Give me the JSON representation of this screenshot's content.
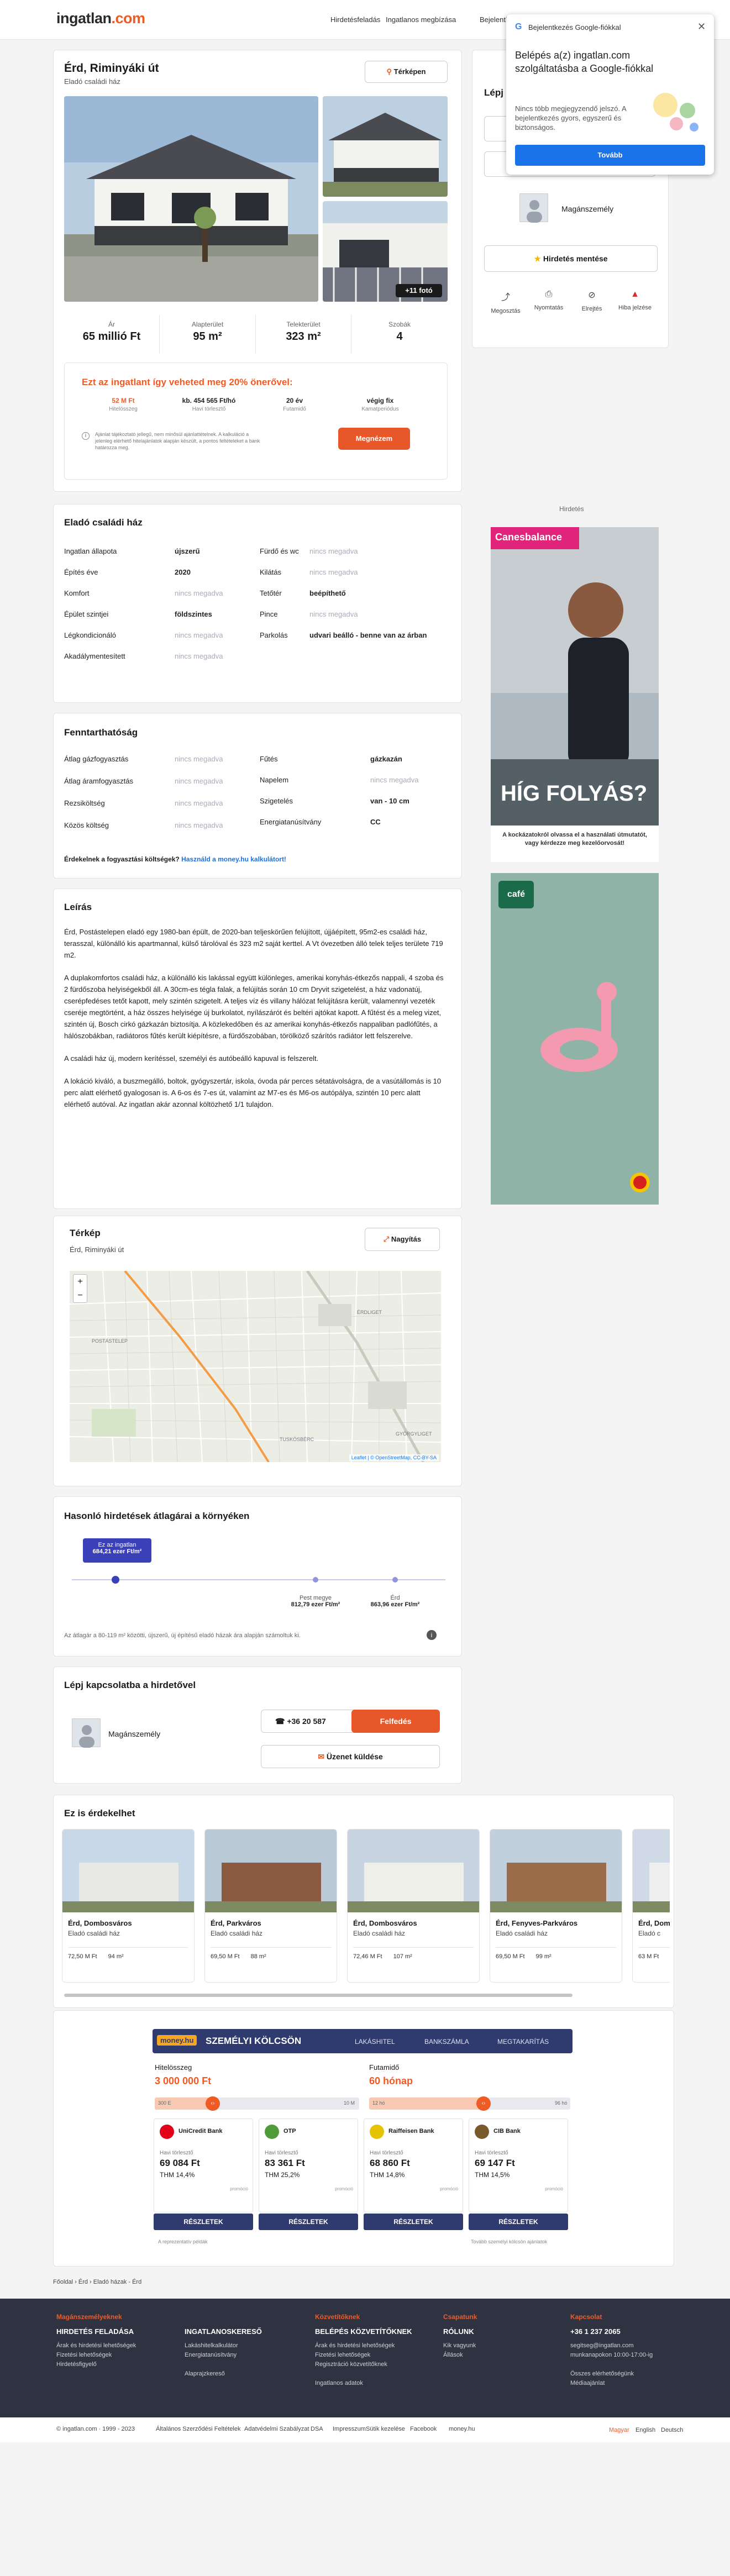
{
  "header": {
    "logo_a": "ingatlan",
    "logo_b": ".com",
    "nav": [
      "Hirdetésfeladás",
      "Ingatlanos megbízása",
      "Bejelentkezés"
    ]
  },
  "google_popup": {
    "title": "Bejelentkezés Google-fiókkal",
    "heading": "Belépés a(z) ingatlan.com szolgáltatásba a Google-fiókkal",
    "body": "Nincs több megjegyzendő jelszó. A bejelentkezés gyors, egyszerű és biztonságos.",
    "button": "Tovább"
  },
  "listing": {
    "title": "Érd, Riminyáki út",
    "subtitle": "Eladó családi ház",
    "map_button": "Térképen",
    "more_photos": "+11 fotó",
    "stats": [
      {
        "label": "Ár",
        "value": "65 millió Ft"
      },
      {
        "label": "Alapterület",
        "value": "95 m²"
      },
      {
        "label": "Telekterület",
        "value": "323 m²"
      },
      {
        "label": "Szobák",
        "value": "4"
      }
    ]
  },
  "loan_box": {
    "heading": "Ezt az ingatlant így veheted meg 20% önerővel:",
    "items": [
      {
        "value": "52 M Ft",
        "label": "Hitelösszeg"
      },
      {
        "value": "kb. 454 565 Ft/hó",
        "label": "Havi törlesztő"
      },
      {
        "value": "20 év",
        "label": "Futamidő"
      },
      {
        "value": "végig fix",
        "label": "Kamatperiódus"
      }
    ],
    "note": "Ajánlat tájékoztató jellegű, nem minősül ajánlattételnek. A kalkuláció a jelenleg elérhető hitelajánlatok alapján készült, a pontos feltételeket a bank határozza meg.",
    "button": "Megnézem"
  },
  "sidebar": {
    "contact_title": "Lépj",
    "agent": "Magánszemély",
    "save_ad": "Hirdetés mentése",
    "actions": [
      "Megosztás",
      "Nyomtatás",
      "Elrejtés",
      "Hiba jelzése"
    ],
    "ad_label": "Hirdetés",
    "ad1": {
      "brand": "Canesbalance",
      "headline": "HÍG FOLYÁS?",
      "sub": "A kockázatokról olvassa el a használati útmutatót, vagy kérdezze meg kezelőorvosát!"
    },
    "ad2": {
      "brand": "café"
    }
  },
  "details": {
    "title": "Eladó családi ház",
    "left": [
      {
        "label": "Ingatlan állapota",
        "value": "újszerű",
        "na": false
      },
      {
        "label": "Építés éve",
        "value": "2020",
        "na": false
      },
      {
        "label": "Komfort",
        "value": "nincs megadva",
        "na": true
      },
      {
        "label": "Épület szintjei",
        "value": "földszintes",
        "na": false
      },
      {
        "label": "Légkondicionáló",
        "value": "nincs megadva",
        "na": true
      },
      {
        "label": "Akadálymentesített",
        "value": "nincs megadva",
        "na": true
      }
    ],
    "right": [
      {
        "label": "Fürdő és wc",
        "value": "nincs megadva",
        "na": true
      },
      {
        "label": "Kilátás",
        "value": "nincs megadva",
        "na": true
      },
      {
        "label": "Tetőtér",
        "value": "beépíthető",
        "na": false
      },
      {
        "label": "Pince",
        "value": "nincs megadva",
        "na": true
      },
      {
        "label": "Parkolás",
        "value": "udvari beálló - benne van az árban",
        "na": false
      }
    ]
  },
  "costs": {
    "title": "Fenntarthatóság",
    "left": [
      {
        "label": "Átlag gázfogyasztás",
        "value": "nincs megadva"
      },
      {
        "label": "Átlag áramfogyasztás",
        "value": "nincs megadva"
      },
      {
        "label": "Rezsiköltség",
        "value": "nincs megadva"
      },
      {
        "label": "Közös költség",
        "value": "nincs megadva"
      }
    ],
    "right": [
      {
        "label": "Fűtés",
        "value": "gázkazán",
        "na": false
      },
      {
        "label": "Napelem",
        "value": "nincs megadva",
        "na": true
      },
      {
        "label": "Szigetelés",
        "value": "van - 10 cm",
        "na": false
      },
      {
        "label": "Energiatanúsítvány",
        "value": "CC",
        "na": false
      }
    ],
    "link_text": "Érdekelnek a fogyasztási költségek?",
    "link": "Használd a money.hu kalkulátort!"
  },
  "description": {
    "title": "Leírás",
    "paragraphs": [
      "Érd, Postástelepen eladó egy 1980-ban épült, de 2020-ban teljeskörűen felújított, újjáépített, 95m2-es családi ház, terasszal, különálló kis apartmannal, külső tárolóval és 323 m2 saját kerttel. A Vt övezetben álló telek teljes területe 719 m2.",
      "A duplakomfortos családi ház, a különálló kis lakással együtt különleges, amerikai konyhás-étkezős nappali, 4 szoba és 2 fürdőszoba helyiségekből áll. A 30cm-es tégla falak, a felújítás során 10 cm Dryvit szigetelést, a ház vadonatúj, cserépfedéses tetőt kapott, mely szintén szigetelt. A teljes víz és villany hálózat felújításra került, valamennyi vezeték cseréje megtörtént, a ház összes helyisége új burkolatot, nyílászárót és beltéri ajtókat kapott. A fűtést és a meleg vizet, szintén új, Bosch cirkó gázkazán biztosítja. A közlekedőben és az amerikai konyhás-étkezős nappaliban padlófűtés, a hálószobákban, radiátoros fűtés került kiépítésre, a fürdőszobában, törölköző szárítós radiátor lett felszerelve.",
      "A családi ház új, modern kerítéssel, személyi és autóbeálló kapuval is felszerelt.",
      "A lokáció kiváló, a buszmegálló, boltok, gyógyszertár, iskola, óvoda pár perces sétatávolságra, de a vasútállomás is 10 perc alatt elérhető gyalogosan is. A 6-os és 7-es út, valamint az M7-es és M6-os autópálya, szintén 10 perc alatt elérhető autóval. Az ingatlan akár azonnal költözhető 1/1 tulajdon."
    ]
  },
  "map": {
    "title": "Térkép",
    "address": "Érd, Riminyáki út",
    "button": "Nagyítás",
    "labels": [
      "POSTÁSTELEP",
      "ÉRDLIGET",
      "TUSKÓSBÉRC",
      "GYÖRGYLIGET"
    ],
    "attribution": "Leaflet | © OpenStreetMap, CC-BY-SA"
  },
  "price_stats": {
    "title": "Hasonló hirdetések átlagárai a környéken",
    "bubble_t": "Ez az ingatlan",
    "bubble_v": "684,21 ezer Ft/m²",
    "points": [
      {
        "label": "Pest megye",
        "value": "812,79 ezer Ft/m²"
      },
      {
        "label": "Érd",
        "value": "863,96 ezer Ft/m²"
      }
    ],
    "note": "Az átlagár a 80-119 m² közötti, újszerű, új építésű eladó házak ára alapján számoltuk ki."
  },
  "contact": {
    "title": "Lépj kapcsolatba a hirdetővel",
    "agent": "Magánszemély",
    "phone": "+36 20 587",
    "show": "Felfedés",
    "message": "Üzenet küldése"
  },
  "similar": {
    "title": "Ez is érdekelhet",
    "items": [
      {
        "city": "Érd, Dombosváros",
        "type": "Eladó családi ház",
        "price": "72,50 M Ft",
        "area": "94 m²"
      },
      {
        "city": "Érd, Parkváros",
        "type": "Eladó családi ház",
        "price": "69,50 M Ft",
        "area": "88 m²"
      },
      {
        "city": "Érd, Dombosváros",
        "type": "Eladó családi ház",
        "price": "72,46 M Ft",
        "area": "107 m²"
      },
      {
        "city": "Érd, Fenyves-Parkváros",
        "type": "Eladó családi ház",
        "price": "69,50 M Ft",
        "area": "99 m²"
      },
      {
        "city": "Érd, Dombosváros",
        "type": "Eladó c",
        "price": "63 M Ft",
        "area": ""
      }
    ]
  },
  "loan_widget": {
    "brand": "money.hu",
    "title": "SZEMÉLYI KÖLCSÖN",
    "tabs": [
      "LAKÁSHITEL",
      "BANKSZÁMLA",
      "MEGTAKARÍTÁS"
    ],
    "amount_label": "Hitelösszeg",
    "amount": "3 000 000 Ft",
    "term_label": "Futamidő",
    "term": "60 hónap",
    "amount_ticks": [
      "300 E",
      "10 M"
    ],
    "term_ticks": [
      "12 hó",
      "96 hó"
    ],
    "banks": [
      {
        "name": "UniCredit Bank",
        "label": "Havi törlesztő",
        "value": "69 084 Ft",
        "thm": "THM 14,4%",
        "color": "#e2001a"
      },
      {
        "name": "OTP",
        "label": "Havi törlesztő",
        "value": "83 361 Ft",
        "thm": "THM 25,2%",
        "color": "#4f9b3a"
      },
      {
        "name": "Raiffeisen Bank",
        "label": "Havi törlesztő",
        "value": "68 860 Ft",
        "thm": "THM 14,8%",
        "color": "#e6c300"
      },
      {
        "name": "CIB Bank",
        "label": "Havi törlesztő",
        "value": "69 147 Ft",
        "thm": "THM 14,5%",
        "color": "#7a5a2c"
      }
    ],
    "details": "RÉSZLETEK",
    "promo": "promóció",
    "foot_left": "A reprezentatív példák",
    "foot_right": "Tovább személyi kölcsön ajánlatok"
  },
  "breadcrumb": [
    "Főoldal",
    "Érd",
    "Eladó házak - Érd"
  ],
  "footer": {
    "cols": [
      {
        "h": "Magánszemélyeknek",
        "t": "HIRDETÉS FELADÁSA",
        "links": [
          "Árak és hirdetési lehetőségek",
          "Fizetési lehetőségek",
          "Hirdetésfigyelő"
        ]
      },
      {
        "h": "",
        "t": "INGATLANOSKERESŐ",
        "links": [
          "Lakáshitelkalkulátor",
          "Energiatanúsítvány",
          "",
          "Alaprajzkereső"
        ]
      },
      {
        "h": "Közvetítőknek",
        "t": "BELÉPÉS KÖZVETÍTŐKNEK",
        "links": [
          "Árak és hirdetési lehetőségek",
          "Fizetési lehetőségek",
          "Regisztráció közvetítőknek",
          "",
          "Ingatlanos adatok"
        ]
      },
      {
        "h": "Csapatunk",
        "t": "RÓLUNK",
        "links": [
          "Kik vagyunk",
          "Állások"
        ]
      },
      {
        "h": "Kapcsolat",
        "t": "+36 1 237 2065",
        "links": [
          "segitseg@ingatlan.com",
          "munkanapokon 10:00-17:00-ig",
          "",
          "Összes elérhetőségünk",
          "Médiaajánlat"
        ]
      }
    ],
    "bottom": [
      "© ingatlan.com · 1999 - 2023",
      "Általános Szerződési Feltételek",
      "Adatvédelmi Szabályzat",
      "DSA",
      "Impresszum",
      "Sütik kezelése",
      "Facebook",
      "money.hu"
    ],
    "langs": [
      "Magyar",
      "English",
      "Deutsch"
    ]
  },
  "colors": {
    "brand": "#ef5b25",
    "button": "#e8572a",
    "footer": "#2f3240",
    "loanwidget": "#2f3a6e"
  }
}
